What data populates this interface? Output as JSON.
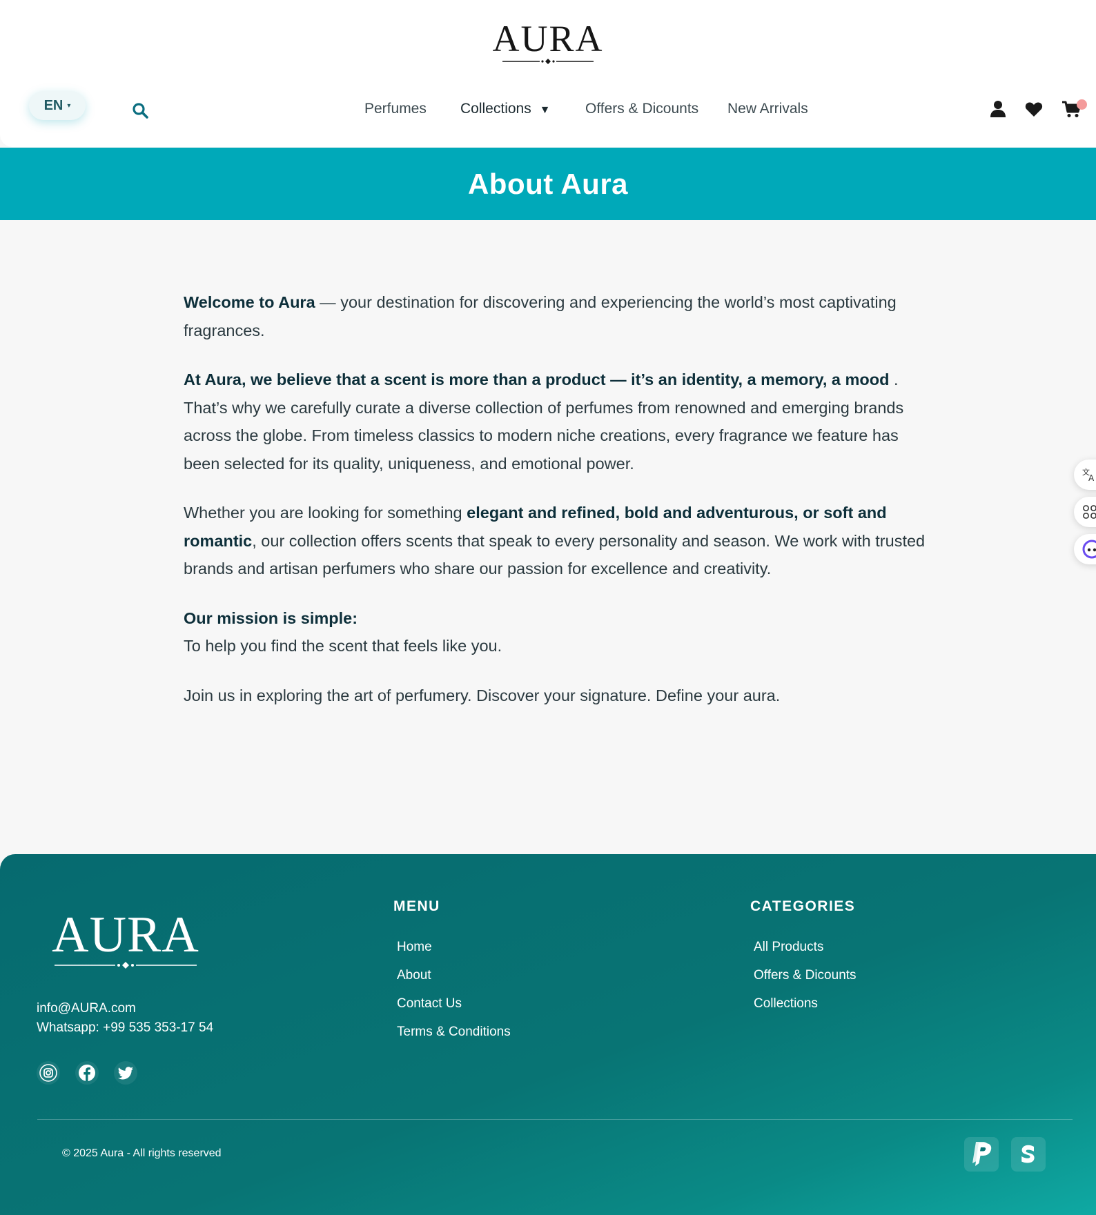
{
  "header": {
    "logo_text": "AURA",
    "language": "EN",
    "nav": {
      "perfumes": "Perfumes",
      "collections": "Collections",
      "offers": "Offers & Dicounts",
      "new_arrivals": "New Arrivals"
    }
  },
  "banner": {
    "title": "About Aura"
  },
  "content": {
    "p1_bold": "Welcome to Aura",
    "p1_text": " — your destination for discovering and experiencing the world’s most captivating fragrances.",
    "p2_bold": "At Aura, we believe that a scent is more than a product — it’s an identity, a memory, a mood",
    "p2_text": " . That’s why we carefully curate a diverse collection of perfumes from renowned and emerging brands across the globe. From timeless classics to modern niche creations, every fragrance we feature has been selected for its quality, uniqueness, and emotional power.",
    "p3_text_a": "Whether you are looking for something ",
    "p3_bold": "elegant and refined, bold and adventurous, or soft and romantic",
    "p3_text_b": ", our collection offers scents that speak to every personality and season. We work with trusted brands and artisan perfumers who share our passion for excellence and creativity.",
    "p4_bold": "Our mission is simple:",
    "p4_text": "To help you find the scent that feels like you.",
    "p5_text": "Join us in exploring the art of perfumery. Discover your signature. Define your aura."
  },
  "footer": {
    "logo_text": "AURA",
    "email": "info@AURA.com",
    "whatsapp": "Whatsapp: +99 535 353-17 54",
    "menu_title": "MENU",
    "menu_items": [
      "Home",
      "About",
      "Contact Us",
      "Terms & Conditions"
    ],
    "categories_title": "CATEGORIES",
    "category_items": [
      "All Products",
      "Offers & Dicounts",
      "Collections"
    ],
    "copyright": "© 2025 Aura - All rights reserved"
  },
  "colors": {
    "banner": "#00a9b9",
    "footer": "#087474",
    "heading_text": "#0d2f3a"
  },
  "icons": [
    "search-icon",
    "user-icon",
    "heart-icon",
    "cart-icon",
    "translate-icon",
    "apps-icon",
    "assistant-icon",
    "instagram-icon",
    "facebook-icon",
    "twitter-icon",
    "paypal-icon",
    "stripe-icon"
  ]
}
